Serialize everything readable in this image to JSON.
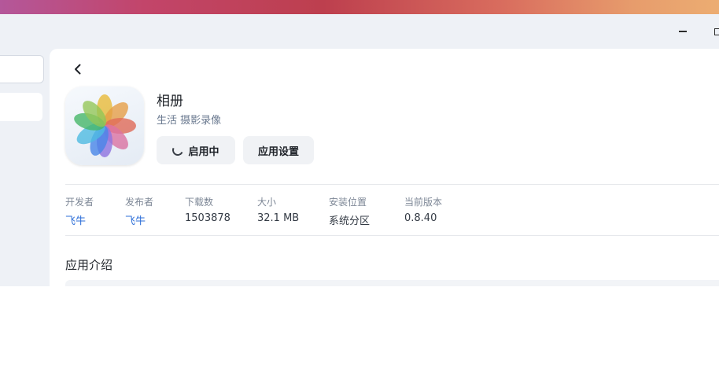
{
  "window": {
    "minimize_icon": "minimize-icon",
    "maximize_icon": "maximize-icon"
  },
  "app": {
    "name": "相册",
    "categories": "生活 摄影录像",
    "launch_label": "启用中",
    "settings_label": "应用设置"
  },
  "info": [
    {
      "label": "开发者",
      "value": "飞牛"
    },
    {
      "label": "发布者",
      "value": "飞牛"
    },
    {
      "label": "下载数",
      "value": "1503878"
    },
    {
      "label": "大小",
      "value": "32.1 MB"
    },
    {
      "label": "安装位置",
      "value": "系统分区"
    },
    {
      "label": "当前版本",
      "value": "0.8.40"
    }
  ],
  "section": {
    "intro_title": "应用介绍"
  },
  "colors": {
    "accent_link": "#2e6fd8",
    "panel_bg": "#ffffff",
    "window_bg": "#eef1f6"
  }
}
